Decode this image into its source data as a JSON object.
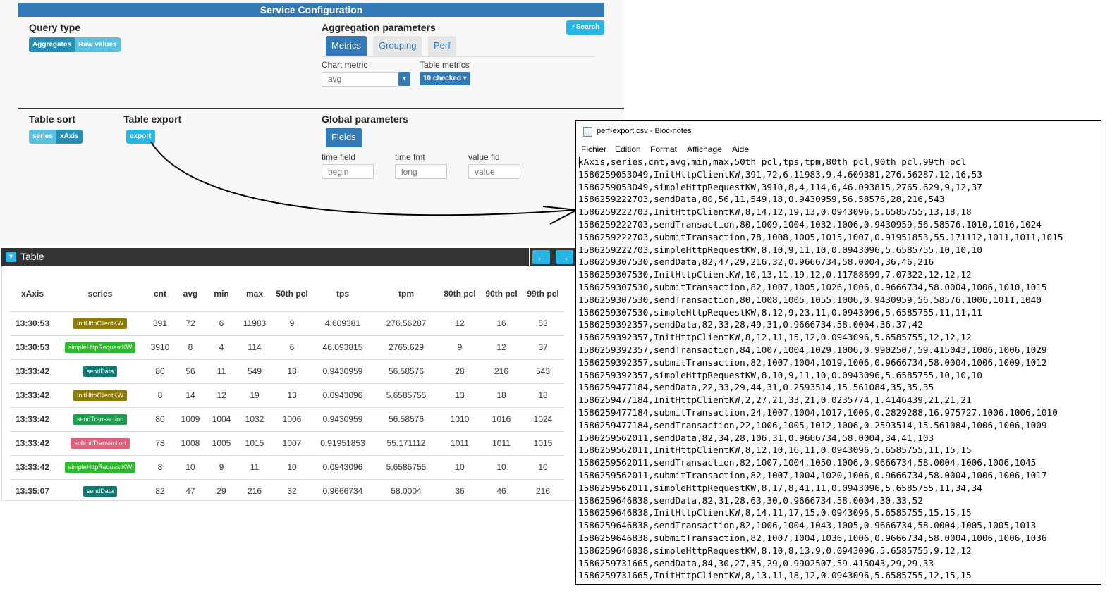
{
  "config": {
    "title": "Service Configuration",
    "search_label": "Search",
    "query_type": {
      "title": "Query type",
      "options": [
        "Aggregates",
        "Raw values"
      ]
    },
    "aggregation": {
      "title": "Aggregation parameters",
      "tabs": [
        "Metrics",
        "Grouping",
        "Perf"
      ],
      "chart_metric_label": "Chart metric",
      "chart_metric_value": "avg",
      "table_metrics_label": "Table metrics",
      "table_metrics_value": "10 checked"
    },
    "table_sort": {
      "title": "Table sort",
      "options": [
        "series",
        "xAxis"
      ]
    },
    "table_export": {
      "title": "Table export",
      "button": "export"
    },
    "global": {
      "title": "Global parameters",
      "tab": "Fields",
      "time_field_label": "time field",
      "time_field_placeholder": "begin",
      "time_fmt_label": "time fmt",
      "time_fmt_placeholder": "long",
      "value_fld_label": "value fld",
      "value_fld_placeholder": "value"
    }
  },
  "table": {
    "title": "Table",
    "columns": [
      "xAxis",
      "series",
      "cnt",
      "avg",
      "min",
      "max",
      "50th pcl",
      "tps",
      "tpm",
      "80th pcl",
      "90th pcl",
      "99th pcl"
    ],
    "rows": [
      {
        "xAxis": "13:30:53",
        "series": "InitHttpClientKW",
        "color": "#8a7a00",
        "cnt": "391",
        "avg": "72",
        "min": "6",
        "max": "11983",
        "p50": "9",
        "tps": "4.609381",
        "tpm": "276.56287",
        "p80": "12",
        "p90": "16",
        "p99": "53"
      },
      {
        "xAxis": "13:30:53",
        "series": "simpleHttpRequestKW",
        "color": "#2eb82e",
        "cnt": "3910",
        "avg": "8",
        "min": "4",
        "max": "114",
        "p50": "6",
        "tps": "46.093815",
        "tpm": "2765.629",
        "p80": "9",
        "p90": "12",
        "p99": "37"
      },
      {
        "xAxis": "13:33:42",
        "series": "sendData",
        "color": "#117a72",
        "cnt": "80",
        "avg": "56",
        "min": "11",
        "max": "549",
        "p50": "18",
        "tps": "0.9430959",
        "tpm": "56.58576",
        "p80": "28",
        "p90": "216",
        "p99": "543"
      },
      {
        "xAxis": "13:33:42",
        "series": "InitHttpClientKW",
        "color": "#8a7a00",
        "cnt": "8",
        "avg": "14",
        "min": "12",
        "max": "19",
        "p50": "13",
        "tps": "0.0943096",
        "tpm": "5.6585755",
        "p80": "13",
        "p90": "18",
        "p99": "18"
      },
      {
        "xAxis": "13:33:42",
        "series": "sendTransaction",
        "color": "#1f9e4f",
        "cnt": "80",
        "avg": "1009",
        "min": "1004",
        "max": "1032",
        "p50": "1006",
        "tps": "0.9430959",
        "tpm": "56.58576",
        "p80": "1010",
        "p90": "1016",
        "p99": "1024"
      },
      {
        "xAxis": "13:33:42",
        "series": "submitTransaction",
        "color": "#e0607a",
        "cnt": "78",
        "avg": "1008",
        "min": "1005",
        "max": "1015",
        "p50": "1007",
        "tps": "0.91951853",
        "tpm": "55.171112",
        "p80": "1011",
        "p90": "1011",
        "p99": "1015"
      },
      {
        "xAxis": "13:33:42",
        "series": "simpleHttpRequestKW",
        "color": "#2eb82e",
        "cnt": "8",
        "avg": "10",
        "min": "9",
        "max": "11",
        "p50": "10",
        "tps": "0.0943096",
        "tpm": "5.6585755",
        "p80": "10",
        "p90": "10",
        "p99": "10"
      },
      {
        "xAxis": "13:35:07",
        "series": "sendData",
        "color": "#117a72",
        "cnt": "82",
        "avg": "47",
        "min": "29",
        "max": "216",
        "p50": "32",
        "tps": "0.9666734",
        "tpm": "58.0004",
        "p80": "36",
        "p90": "46",
        "p99": "216"
      }
    ]
  },
  "notepad": {
    "title": "perf-export.csv - Bloc-notes",
    "menu": [
      "Fichier",
      "Edition",
      "Format",
      "Affichage",
      "Aide"
    ],
    "lines": [
      "xAxis,series,cnt,avg,min,max,50th pcl,tps,tpm,80th pcl,90th pcl,99th pcl",
      "1586259053049,InitHttpClientKW,391,72,6,11983,9,4.609381,276.56287,12,16,53",
      "1586259053049,simpleHttpRequestKW,3910,8,4,114,6,46.093815,2765.629,9,12,37",
      "1586259222703,sendData,80,56,11,549,18,0.9430959,56.58576,28,216,543",
      "1586259222703,InitHttpClientKW,8,14,12,19,13,0.0943096,5.6585755,13,18,18",
      "1586259222703,sendTransaction,80,1009,1004,1032,1006,0.9430959,56.58576,1010,1016,1024",
      "1586259222703,submitTransaction,78,1008,1005,1015,1007,0.91951853,55.171112,1011,1011,1015",
      "1586259222703,simpleHttpRequestKW,8,10,9,11,10,0.0943096,5.6585755,10,10,10",
      "1586259307530,sendData,82,47,29,216,32,0.9666734,58.0004,36,46,216",
      "1586259307530,InitHttpClientKW,10,13,11,19,12,0.11788699,7.07322,12,12,12",
      "1586259307530,submitTransaction,82,1007,1005,1026,1006,0.9666734,58.0004,1006,1010,1015",
      "1586259307530,sendTransaction,80,1008,1005,1055,1006,0.9430959,56.58576,1006,1011,1040",
      "1586259307530,simpleHttpRequestKW,8,12,9,23,11,0.0943096,5.6585755,11,11,11",
      "1586259392357,sendData,82,33,28,49,31,0.9666734,58.0004,36,37,42",
      "1586259392357,InitHttpClientKW,8,12,11,15,12,0.0943096,5.6585755,12,12,12",
      "1586259392357,sendTransaction,84,1007,1004,1029,1006,0.9902507,59.415043,1006,1006,1029",
      "1586259392357,submitTransaction,82,1007,1004,1019,1006,0.9666734,58.0004,1006,1009,1012",
      "1586259392357,simpleHttpRequestKW,8,10,9,11,10,0.0943096,5.6585755,10,10,10",
      "1586259477184,sendData,22,33,29,44,31,0.2593514,15.561084,35,35,35",
      "1586259477184,InitHttpClientKW,2,27,21,33,21,0.0235774,1.4146439,21,21,21",
      "1586259477184,submitTransaction,24,1007,1004,1017,1006,0.2829288,16.975727,1006,1006,1010",
      "1586259477184,sendTransaction,22,1006,1005,1012,1006,0.2593514,15.561084,1006,1006,1009",
      "1586259562011,sendData,82,34,28,106,31,0.9666734,58.0004,34,41,103",
      "1586259562011,InitHttpClientKW,8,12,10,16,11,0.0943096,5.6585755,11,15,15",
      "1586259562011,sendTransaction,82,1007,1004,1050,1006,0.9666734,58.0004,1006,1006,1045",
      "1586259562011,submitTransaction,82,1007,1004,1020,1006,0.9666734,58.0004,1006,1006,1017",
      "1586259562011,simpleHttpRequestKW,8,17,8,41,11,0.0943096,5.6585755,11,34,34",
      "1586259646838,sendData,82,31,28,63,30,0.9666734,58.0004,30,33,52",
      "1586259646838,InitHttpClientKW,8,14,11,17,15,0.0943096,5.6585755,15,15,15",
      "1586259646838,sendTransaction,82,1006,1004,1043,1005,0.9666734,58.0004,1005,1005,1013",
      "1586259646838,submitTransaction,82,1007,1004,1036,1006,0.9666734,58.0004,1006,1006,1036",
      "1586259646838,simpleHttpRequestKW,8,10,8,13,9,0.0943096,5.6585755,9,12,12",
      "1586259731665,sendData,84,30,27,35,29,0.9902507,59.415043,29,29,33",
      "1586259731665,InitHttpClientKW,8,13,11,18,12,0.0943096,5.6585755,12,15,15"
    ]
  }
}
